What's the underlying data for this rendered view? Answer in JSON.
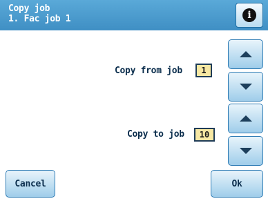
{
  "header": {
    "title": "Copy job",
    "subtitle": "1. Fac job 1",
    "info_icon": "info-icon"
  },
  "copy_from": {
    "label": "Copy from job",
    "value": "1",
    "up_icon": "arrow-up-icon",
    "down_icon": "arrow-down-icon"
  },
  "copy_to": {
    "label": "Copy to job",
    "value": "10",
    "up_icon": "arrow-up-icon",
    "down_icon": "arrow-down-icon"
  },
  "footer": {
    "cancel_label": "Cancel",
    "ok_label": "Ok"
  },
  "colors": {
    "title_bar": "#4a9bd0",
    "button_fill": "#c3e1f3",
    "value_fill": "#f7e8a3"
  }
}
